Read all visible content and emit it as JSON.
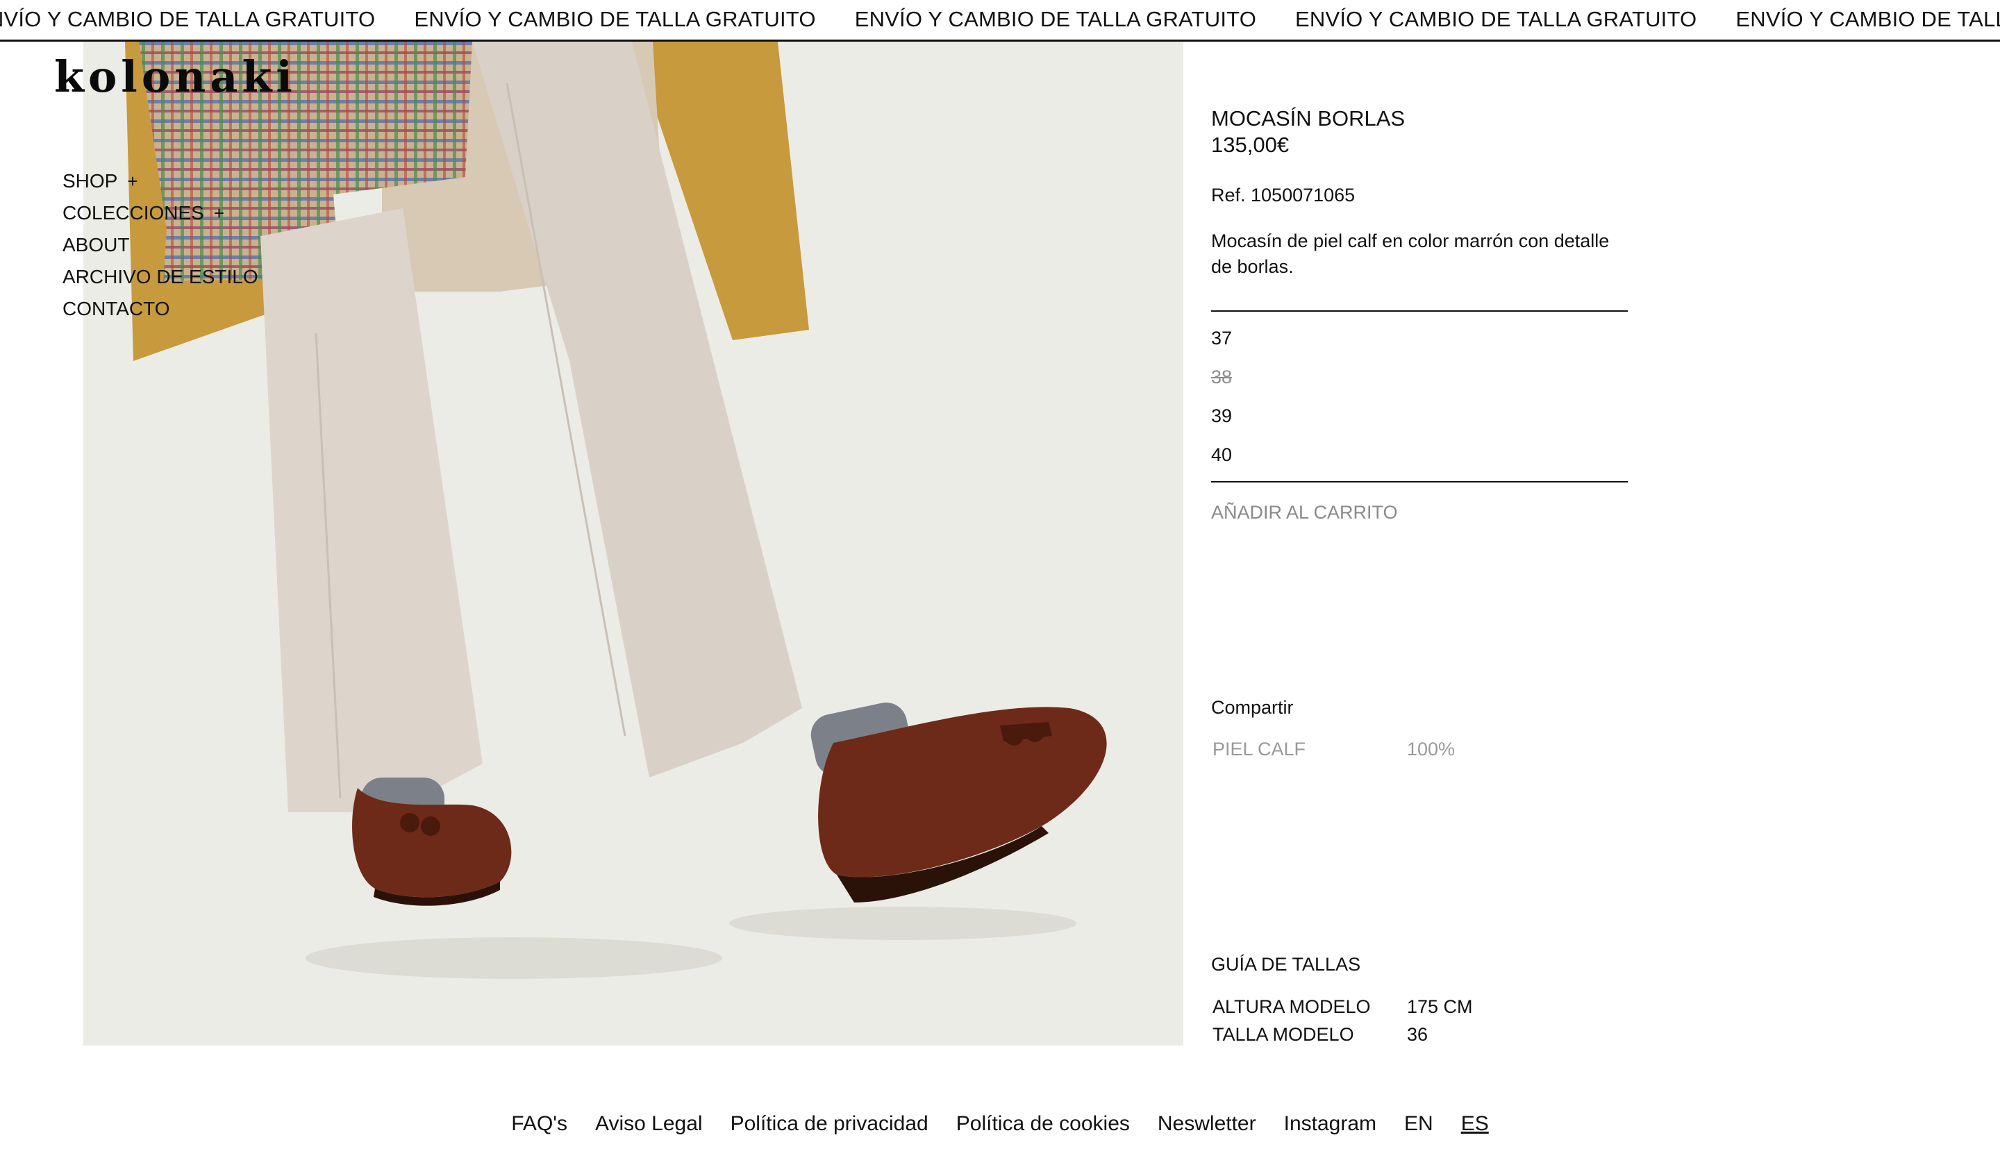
{
  "marquee": {
    "items": [
      "ENVÍO Y CAMBIO DE TALLA GRATUITO",
      "ENVÍO Y CAMBIO DE TALLA GRATUITO",
      "ENVÍO Y CAMBIO DE TALLA GRATUITO",
      "ENVÍO Y CAMBIO DE TALLA GRATUITO",
      "ENVÍO Y CAMBIO DE TALLA GRATUITO"
    ]
  },
  "brand": {
    "logo_text": "kolonaki"
  },
  "nav": {
    "items": [
      {
        "label": "SHOP",
        "expander": "+"
      },
      {
        "label": "COLECCIONES",
        "expander": "+"
      },
      {
        "label": "ABOUT"
      },
      {
        "label": "ARCHIVO DE ESTILO"
      },
      {
        "label": "CONTACTO"
      }
    ]
  },
  "product": {
    "title": "MOCASÍN BORLAS",
    "price": "135,00€",
    "ref": "Ref. 1050071065",
    "description": "Mocasín de piel calf en color marrón con detalle de borlas.",
    "sizes": [
      {
        "label": "37",
        "available": true
      },
      {
        "label": "38",
        "available": false
      },
      {
        "label": "39",
        "available": true
      },
      {
        "label": "40",
        "available": true
      }
    ],
    "add_to_cart": "AÑADIR AL CARRITO",
    "share": "Compartir",
    "composition": {
      "material": "PIEL CALF",
      "percent": "100%"
    },
    "size_guide": "GUÍA DE TALLAS",
    "model": {
      "height_label": "ALTURA MODELO",
      "height_value": "175 CM",
      "size_label": "TALLA MODELO",
      "size_value": "36"
    }
  },
  "footer": {
    "links": [
      "FAQ's",
      "Aviso Legal",
      "Política de privacidad",
      "Política de cookies",
      "Neswletter",
      "Instagram"
    ],
    "lang_en": "EN",
    "lang_es": "ES"
  },
  "colors": {
    "background": "#ffffff",
    "text": "#111111",
    "muted": "#8a8a8a",
    "photo_bg": "#ecece6",
    "loafer": "#6e2a18",
    "coat": "#c79a3e",
    "trousers": "#ddd5cc"
  }
}
